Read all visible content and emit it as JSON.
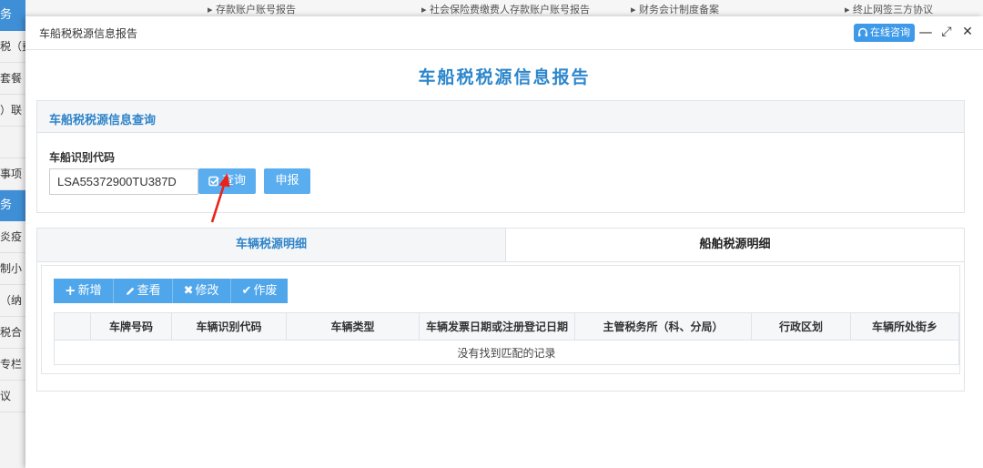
{
  "background": {
    "sidebar": [
      {
        "text": "务",
        "type": "section"
      },
      {
        "text": "税（费",
        "type": "item"
      },
      {
        "text": "套餐",
        "type": "item"
      },
      {
        "text": "）联",
        "type": "item"
      },
      {
        "text": "",
        "type": "item"
      },
      {
        "text": "事项",
        "type": "item"
      },
      {
        "text": "务",
        "type": "section"
      },
      {
        "text": "炎疫",
        "type": "item"
      },
      {
        "text": "制小",
        "type": "item"
      },
      {
        "text": "（纳",
        "type": "item"
      },
      {
        "text": "税合",
        "type": "item"
      },
      {
        "text": "专栏",
        "type": "item"
      },
      {
        "text": "议",
        "type": "item"
      }
    ],
    "topbar": [
      "▸ 存款账户账号报告",
      "▸ 社会保险费缴费人存款账户账号报告",
      "▸ 财务会计制度备案",
      "▸ 终止网签三方协议"
    ]
  },
  "dialog": {
    "title": "车船税税源信息报告",
    "online_label": "在线咨询",
    "minimize": "—",
    "maximize": "⤢",
    "close": "✕"
  },
  "page_title": "车船税税源信息报告",
  "query_panel": {
    "header": "车船税税源信息查询",
    "field_label": "车船识别代码",
    "vin_value": "LSA55372900TU387D",
    "query_button": "查询",
    "declare_button": "申报"
  },
  "tabs": [
    {
      "label": "车辆税源明细",
      "active": true
    },
    {
      "label": "船舶税源明细",
      "active": false
    }
  ],
  "toolbar": {
    "add": "新增",
    "view": "查看",
    "edit": "修改",
    "void": "作废"
  },
  "table": {
    "columns": [
      "",
      "车牌号码",
      "车辆识别代码",
      "车辆类型",
      "车辆发票日期或注册登记日期",
      "主管税务所（科、分局）",
      "行政区划",
      "车辆所处街乡"
    ],
    "empty_message": "没有找到匹配的记录"
  },
  "colors": {
    "accent": "#2f84c8",
    "button": "#5aaef0",
    "annotation_arrow": "#e8231b"
  }
}
